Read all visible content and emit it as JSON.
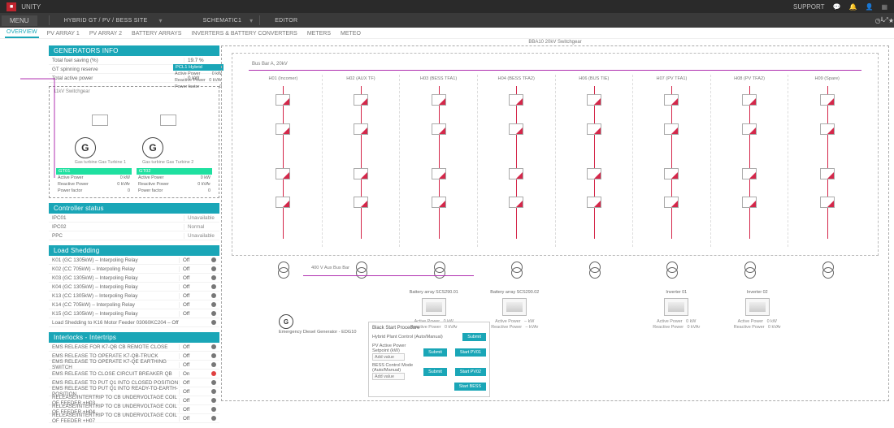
{
  "app": {
    "support": "SUPPORT",
    "brand": "UNITY"
  },
  "menu": {
    "label": "MENU",
    "crumb": "HYBRID GT / PV / BESS SITE",
    "schematic": "SCHEMATIC1",
    "mode": "EDITOR"
  },
  "tabs": [
    "OVERVIEW",
    "PV ARRAY 1",
    "PV ARRAY 2",
    "BATTERY ARRAYS",
    "INVERTERS & BATTERY CONVERTERS",
    "METERS",
    "METEO"
  ],
  "geninfo": {
    "title": "GENERATORS INFO",
    "rows": [
      {
        "k": "Total fuel saving (%)",
        "v": "19.7 %"
      },
      {
        "k": "GT spinning reserve",
        "v": "- %"
      },
      {
        "k": "Total active power",
        "v": "0 kW"
      }
    ],
    "swlabel": "11kV Switchgear",
    "gens": [
      {
        "name": "GT01",
        "sub": "Gas turbine Gas Turbine 1"
      },
      {
        "name": "GT02",
        "sub": "Gas turbine Gas Turbine 2"
      }
    ],
    "stats": [
      {
        "k": "Active Power",
        "v": "0 kW"
      },
      {
        "k": "Reactive Power",
        "v": "0 kVAr"
      },
      {
        "k": "Power factor",
        "v": "0"
      }
    ],
    "hybrid": {
      "hdr": "PCL1 Hybrid",
      "rows": [
        {
          "k": "Active Power",
          "v": "0 kW"
        },
        {
          "k": "Reactive Power",
          "v": "0 kVAr"
        },
        {
          "k": "Power factor",
          "v": "0"
        }
      ]
    }
  },
  "controller": {
    "title": "Controller status",
    "rows": [
      {
        "k": "IPC01",
        "v": "Unavailable"
      },
      {
        "k": "IPC02",
        "v": "Normal"
      },
      {
        "k": "PPC",
        "v": "Unavailable"
      }
    ]
  },
  "shedding": {
    "title": "Load Shedding",
    "rows": [
      {
        "k": "K01 (GC 1305kW) – Interpoling Relay",
        "v": "Off"
      },
      {
        "k": "K02 (CC 705kW) – Interpoling Relay",
        "v": "Off"
      },
      {
        "k": "K03 (GC 1305kW) – Interpoling Relay",
        "v": "Off"
      },
      {
        "k": "K04 (GC 1305kW) – Interpoling Relay",
        "v": "Off"
      },
      {
        "k": "K13 (CC 1305kW) – Interpoling Relay",
        "v": "Off"
      },
      {
        "k": "K14 (CC 705kW) – Interpoling Relay",
        "v": "Off"
      },
      {
        "k": "K15 (GC 1305kW) – Interpoling Relay",
        "v": "Off"
      },
      {
        "k": "Load Shedding to K16 Motor Feeder 03060KC204 – Off",
        "v": ""
      }
    ]
  },
  "interlocks": {
    "title": "Interlocks - Intertrips",
    "rows": [
      {
        "k": "EMS RELEASE FOR K7-QB CB REMOTE CLOSE",
        "v": "Off"
      },
      {
        "k": "EMS RELEASE TO OPERATE K7-QB-TRUCK",
        "v": "Off"
      },
      {
        "k": "EMS RELEASE TO OPERATE K7-QE EARTHING SWITCH",
        "v": "Off"
      },
      {
        "k": "EMS RELEASE TO CLOSE CIRCUIT BREAKER QB",
        "v": "On",
        "red": true
      },
      {
        "k": "EMS RELEASE TO PUT Q1 INTO CLOSED POSITION",
        "v": "Off"
      },
      {
        "k": "EMS RELEASE TO PUT Q1 INTO READY-TO-EARTH-POSITION",
        "v": "Off"
      },
      {
        "k": "RELEASE/INTERTRIP TO CB UNDERVOLTAGE COIL OF FEEDER +H03",
        "v": "Off"
      },
      {
        "k": "RELEASE/INTERTRIP TO CB UNDERVOLTAGE COIL OF FEEDER +H04",
        "v": "Off"
      },
      {
        "k": "RELEASE/INTERTRIP TO CB UNDERVOLTAGE COIL OF FEEDER +H07",
        "v": "Off"
      }
    ]
  },
  "schematic": {
    "swlabel": "BBA10 20kV Switchgear",
    "busA": "Bus Bar A, 20kV",
    "feeders": [
      "H01 (Incomer)",
      "H02 (AUX TF)",
      "H03 (BESS TFA1)",
      "H04 (BESS TFA2)",
      "H06 (BUS TIE)",
      "H07 (PV TFA1)",
      "H08 (PV TFA2)",
      "H09 (Spare)"
    ],
    "auxbus": "400 V Aux Bus Bar",
    "edg": "Emergency Diesel Generator - EDG10",
    "devices": [
      {
        "name": "Battery array SCS290.01",
        "ap": "Active Power",
        "apv": "0 kW",
        "rp": "Reactive Power",
        "rpv": "0 kVAr"
      },
      {
        "name": "Battery array SCS290.02",
        "ap": "Active Power",
        "apv": "– kW",
        "rp": "Reactive Power",
        "rpv": "– kVAr"
      },
      {
        "name": "Inverter 01",
        "ap": "Active Power",
        "apv": "0 kW",
        "rp": "Reactive Power",
        "rpv": "0 kVAr"
      },
      {
        "name": "Inverter 02",
        "ap": "Active Power",
        "apv": "0 kW",
        "rp": "Reactive Power",
        "rpv": "0 kVAr"
      }
    ]
  },
  "blackstart": {
    "title": "Black Start Procedure",
    "rows": [
      {
        "k": "Hybrid Plant Control (Auto/Manual)",
        "btn": "Submit",
        "act": ""
      },
      {
        "k": "PV Active Power Setpoint (kW)",
        "btn": "Submit",
        "act": "Start PV01",
        "ph": "Add value"
      },
      {
        "k": "BESS Control Mode (Auto/Manual)",
        "btn": "Submit",
        "act": "Start PV02",
        "ph": "Add value"
      },
      {
        "k": "",
        "btn": "",
        "act": "Start BESS"
      }
    ]
  }
}
